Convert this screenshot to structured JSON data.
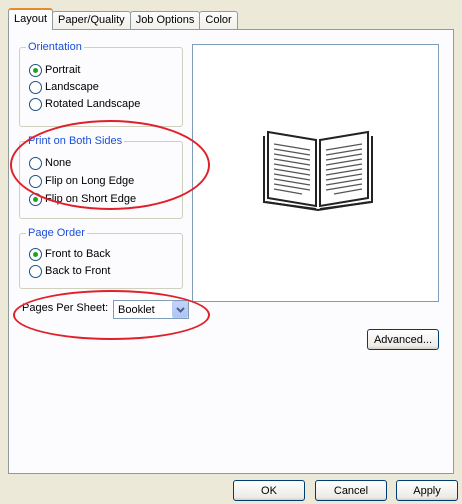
{
  "tabs": [
    "Layout",
    "Paper/Quality",
    "Job Options",
    "Color"
  ],
  "orientation": {
    "title": "Orientation",
    "options": [
      "Portrait",
      "Landscape",
      "Rotated Landscape"
    ],
    "selected": "Portrait"
  },
  "duplex": {
    "title": "Print on Both Sides",
    "options": [
      "None",
      "Flip on Long Edge",
      "Flip on Short Edge"
    ],
    "selected": "Flip on Short Edge"
  },
  "page_order": {
    "title": "Page Order",
    "options": [
      "Front to Back",
      "Back to Front"
    ],
    "selected": "Front to Back"
  },
  "pages_per_sheet": {
    "label": "Pages Per Sheet:",
    "value": "Booklet"
  },
  "buttons": {
    "advanced": "Advanced...",
    "ok": "OK",
    "cancel": "Cancel",
    "apply": "Apply"
  },
  "preview_icon": "open-book-icon",
  "highlight_color": "#e0202a",
  "group_title_color": "#1a4fd6",
  "tab_accent_color": "#e68b2c"
}
